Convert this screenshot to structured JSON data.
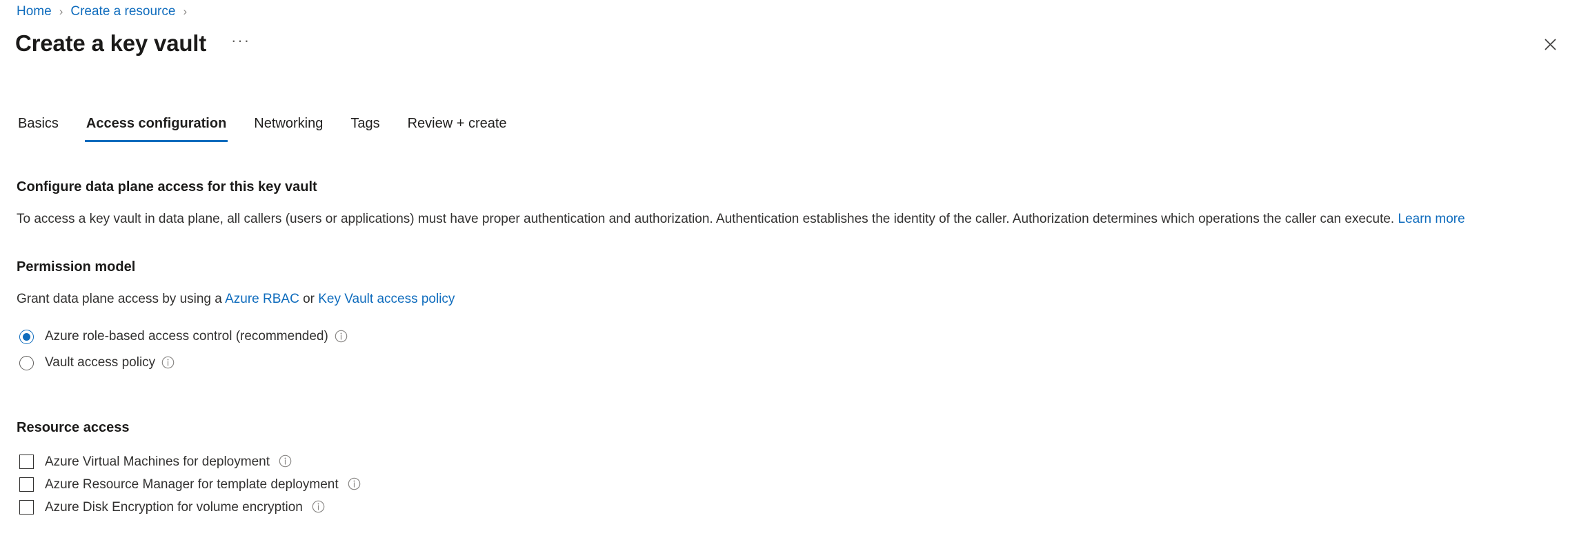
{
  "breadcrumb": {
    "items": [
      {
        "label": "Home"
      },
      {
        "label": "Create a resource"
      }
    ],
    "separator": "›"
  },
  "header": {
    "title": "Create a key vault",
    "ellipsis_label": "···",
    "close_label": "Close"
  },
  "tabs": [
    {
      "label": "Basics",
      "active": false
    },
    {
      "label": "Access configuration",
      "active": true
    },
    {
      "label": "Networking",
      "active": false
    },
    {
      "label": "Tags",
      "active": false
    },
    {
      "label": "Review + create",
      "active": false
    }
  ],
  "main": {
    "configure_heading": "Configure data plane access for this key vault",
    "intro_text": "To access a key vault in data plane, all callers (users or applications) must have proper authentication and authorization. Authentication establishes the identity of the caller. Authorization determines which operations the caller can execute.",
    "intro_link": "Learn more",
    "permission_model": {
      "heading": "Permission model",
      "description_prefix": "Grant data plane access by using a ",
      "link_rbac": "Azure RBAC",
      "description_middle": " or ",
      "link_policy": "Key Vault access policy",
      "options": [
        {
          "label": "Azure role-based access control (recommended)",
          "selected": true,
          "info": "ⓘ"
        },
        {
          "label": "Vault access policy",
          "selected": false,
          "info": "ⓘ"
        }
      ]
    },
    "resource_access": {
      "heading": "Resource access",
      "options": [
        {
          "label": "Azure Virtual Machines for deployment",
          "checked": false
        },
        {
          "label": "Azure Resource Manager for template deployment",
          "checked": false
        },
        {
          "label": "Azure Disk Encryption for volume encryption",
          "checked": false
        }
      ]
    }
  },
  "colors": {
    "link": "#0f6cbd",
    "accent": "#0f6cbd",
    "text": "#323130",
    "heading": "#1b1a19",
    "muted": "#605e5c"
  }
}
